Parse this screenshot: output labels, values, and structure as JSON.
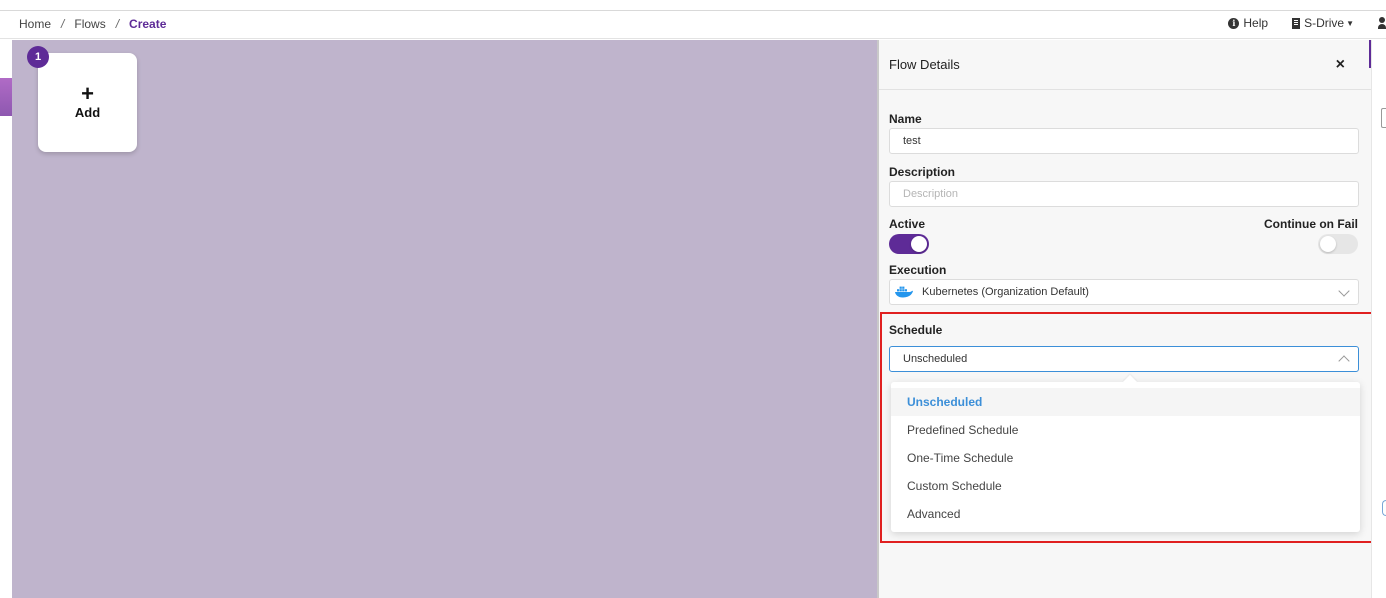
{
  "breadcrumb": {
    "items": [
      "Home",
      "Flows",
      "Create"
    ],
    "separator": "/"
  },
  "header": {
    "help_label": "Help",
    "help_icon": "info-circle-icon",
    "org_label": "S-Drive",
    "org_icon": "building-icon",
    "user_icon": "user-icon"
  },
  "canvas": {
    "add_card": {
      "plus": "+",
      "label": "Add",
      "step_number": "1"
    }
  },
  "panel": {
    "title": "Flow Details",
    "close": "×",
    "name": {
      "label": "Name",
      "value": "test"
    },
    "description": {
      "label": "Description",
      "placeholder": "Description"
    },
    "active": {
      "label": "Active",
      "on": true
    },
    "continue_on_fail": {
      "label": "Continue on Fail",
      "on": false
    },
    "execution": {
      "label": "Execution",
      "value": "Kubernetes (Organization Default)",
      "icon": "docker-icon"
    },
    "schedule": {
      "label": "Schedule",
      "value": "Unscheduled",
      "options": [
        "Unscheduled",
        "Predefined Schedule",
        "One-Time Schedule",
        "Custom Schedule",
        "Advanced"
      ],
      "selected_index": 0
    }
  },
  "colors": {
    "accent": "#5e2b97",
    "canvas": "#bfb4cc",
    "selected_option": "#3c8fd8",
    "highlight": "#e02020"
  }
}
